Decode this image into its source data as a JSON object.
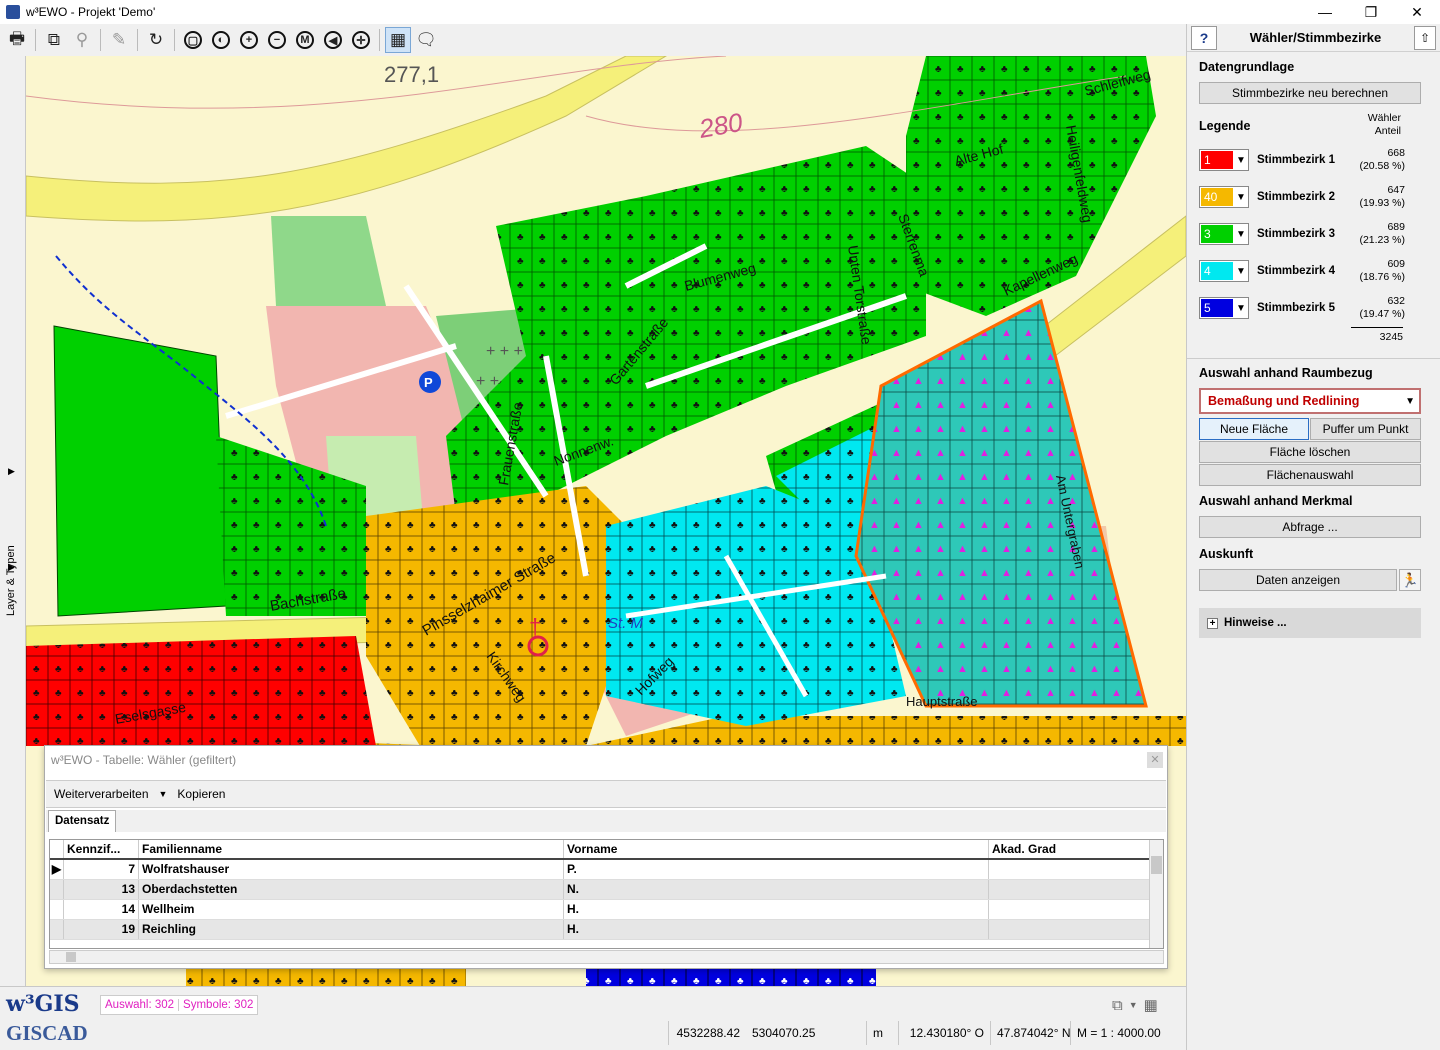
{
  "window": {
    "title": "w³EWO - Projekt 'Demo'",
    "controls": [
      "—",
      "❐",
      "✕"
    ]
  },
  "toolbar": {
    "icons": [
      "print-icon",
      "copy-icon",
      "zoom-icon",
      "edit-icon",
      "refresh-icon",
      "zoom-full-icon",
      "zoom-prev-icon",
      "zoom-in-icon",
      "zoom-out-icon",
      "zoom-m-icon",
      "pan-back-icon",
      "pan-center-icon",
      "table-icon",
      "comment-icon"
    ],
    "zoom_m_label": "M"
  },
  "sidetab": {
    "label": "Layer & Typen"
  },
  "map": {
    "elevation_label": "277,1",
    "contour_label": "280",
    "street_labels": [
      "Bachstraße",
      "Frauenstraße",
      "Blumenweg",
      "Gartenstraße",
      "Alte Hof",
      "Kapellenweg",
      "Pinsselzhaimer Straße",
      "Kirchweg",
      "Eselsgasse",
      "Hofweg",
      "Nonnenw.",
      "St. M",
      "Sterrenma",
      "Unten Torstraße",
      "Am Untergraben",
      "Hauptstraße",
      "Schleifweg",
      "Heiligenfeldweg"
    ],
    "parking_label": "P",
    "colors": {
      "background": "#fbf6cf",
      "district1": "#ff0000",
      "district2": "#f5b800",
      "district3": "#00d000",
      "district4": "#00e8f0",
      "district5": "#0000e0",
      "selection": "#ff6a00",
      "main_road": "#f5f07a"
    }
  },
  "panel": {
    "title": "Wähler/Stimmbezirke",
    "help": "?",
    "datengrundlage_title": "Datengrundlage",
    "recalc_button": "Stimmbezirke neu berechnen",
    "legend_title": "Legende",
    "legend_header": "Wähler Anteil",
    "legend": [
      {
        "value": "1",
        "color": "#ff0000",
        "name": "Stimmbezirk 1",
        "count": "668",
        "share": "(20.58 %)"
      },
      {
        "value": "40",
        "color": "#f5b800",
        "name": "Stimmbezirk 2",
        "count": "647",
        "share": "(19.93 %)"
      },
      {
        "value": "3",
        "color": "#00d000",
        "name": "Stimmbezirk 3",
        "count": "689",
        "share": "(21.23 %)"
      },
      {
        "value": "4",
        "color": "#00e8f0",
        "name": "Stimmbezirk 4",
        "count": "609",
        "share": "(18.76 %)"
      },
      {
        "value": "5",
        "color": "#0000e0",
        "name": "Stimmbezirk 5",
        "count": "632",
        "share": "(19.47 %)"
      }
    ],
    "legend_total": "3245",
    "raumbezug_title": "Auswahl anhand Raumbezug",
    "raumbezug_select": "Bemaßung und Redlining",
    "btn_neue_flaeche": "Neue Fläche",
    "btn_puffer": "Puffer um Punkt",
    "btn_flaeche_loeschen": "Fläche löschen",
    "btn_flaechenauswahl": "Flächenauswahl",
    "merkmal_title": "Auswahl anhand Merkmal",
    "btn_abfrage": "Abfrage ...",
    "auskunft_title": "Auskunft",
    "btn_daten": "Daten anzeigen",
    "hinweise": "Hinweise ..."
  },
  "table": {
    "title": "w³EWO - Tabelle: Wähler (gefiltert)",
    "menu": [
      "Weiterverarbeiten",
      "Kopieren"
    ],
    "tab": "Datensatz",
    "columns": [
      "Kennzif...",
      "Familienname",
      "Vorname",
      "Akad. Grad"
    ],
    "rows": [
      {
        "id": "7",
        "name": "Wolfratshauser",
        "first": "P.",
        "grad": ""
      },
      {
        "id": "13",
        "name": "Oberdachstetten",
        "first": "N.",
        "grad": ""
      },
      {
        "id": "14",
        "name": "Wellheim",
        "first": "H.",
        "grad": ""
      },
      {
        "id": "19",
        "name": "Reichling",
        "first": "H.",
        "grad": ""
      }
    ]
  },
  "status": {
    "logo_top": "w³GIS",
    "logo_bottom": "GISCAD",
    "auswahl": "Auswahl: 302",
    "symbole": "Symbole: 302",
    "coord_x": "4532288.42",
    "coord_y": "5304070.25",
    "unit": "m",
    "lon": "12.430180° O",
    "lat": "47.874042° N",
    "scale": "M = 1 :  4000.00"
  }
}
